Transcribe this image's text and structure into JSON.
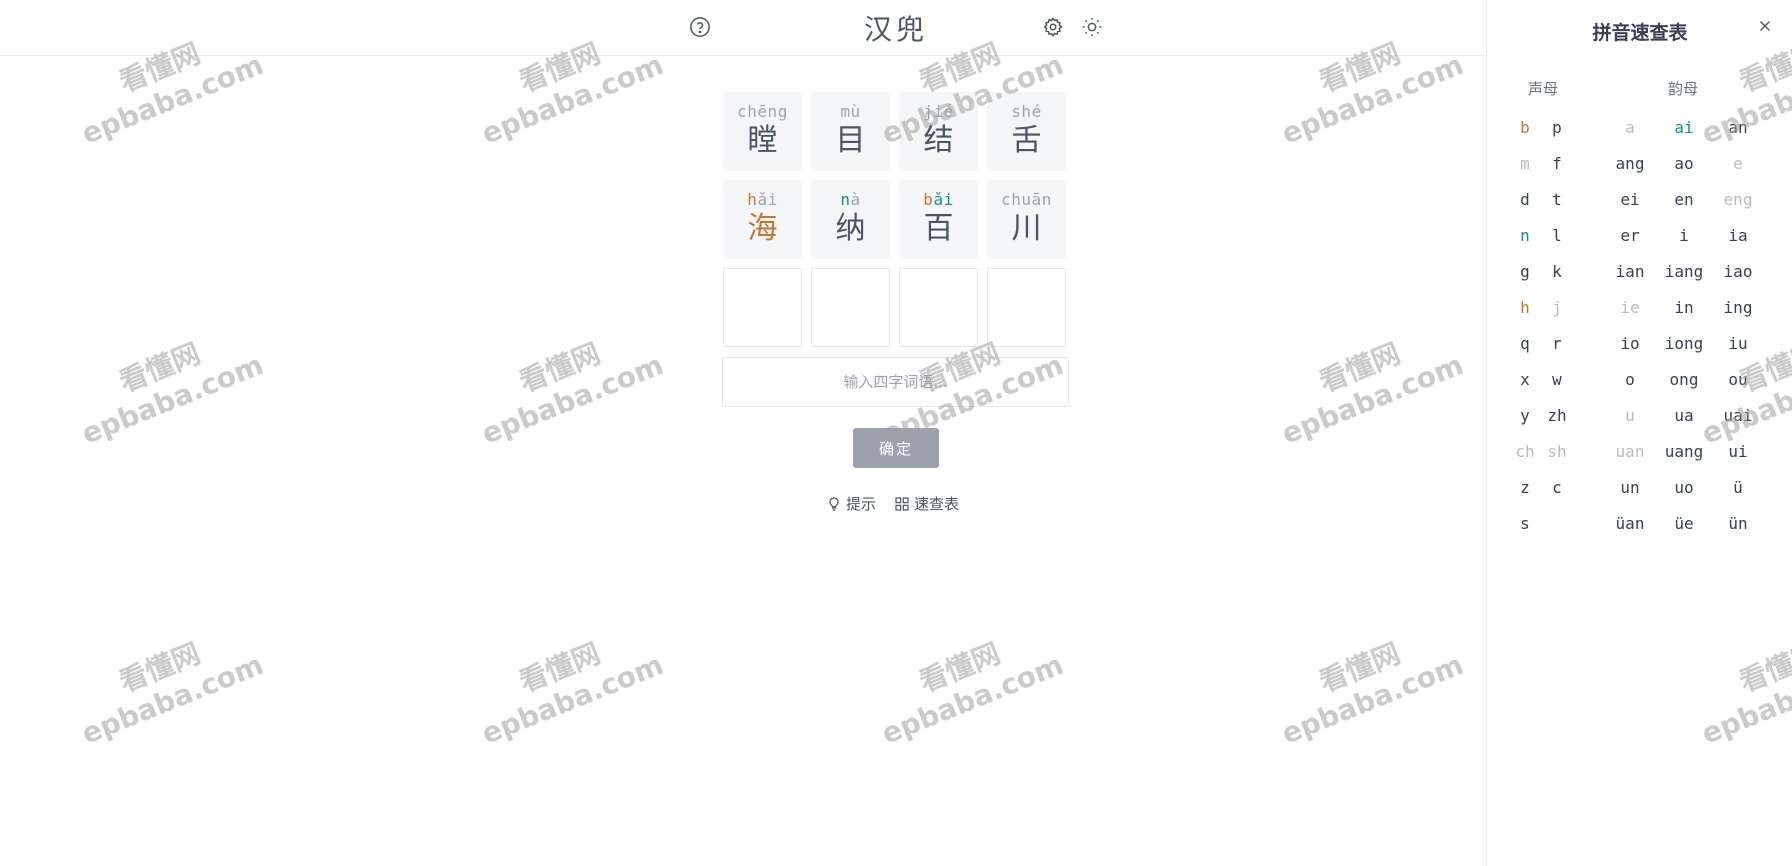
{
  "header": {
    "title": "汉兜",
    "help_icon": "help-circle-icon",
    "settings_icon": "gear-icon",
    "theme_icon": "sun-icon"
  },
  "colors": {
    "present": "#c2772f",
    "correct": "#14908a",
    "absent": "#9ca3af",
    "default": "#4b5563"
  },
  "board": {
    "rows": [
      [
        {
          "pinyin": [
            {
              "t": "ch",
              "s": "absent"
            },
            {
              "t": "ēng",
              "s": "absent"
            }
          ],
          "hanzi": "瞠",
          "hs": "default"
        },
        {
          "pinyin": [
            {
              "t": "m",
              "s": "absent"
            },
            {
              "t": "ù",
              "s": "absent"
            }
          ],
          "hanzi": "目",
          "hs": "default"
        },
        {
          "pinyin": [
            {
              "t": "j",
              "s": "absent"
            },
            {
              "t": "ié",
              "s": "absent"
            }
          ],
          "hanzi": "结",
          "hs": "default"
        },
        {
          "pinyin": [
            {
              "t": "sh",
              "s": "absent"
            },
            {
              "t": "é",
              "s": "absent"
            }
          ],
          "hanzi": "舌",
          "hs": "default"
        }
      ],
      [
        {
          "pinyin": [
            {
              "t": "h",
              "s": "present"
            },
            {
              "t": "ǎi",
              "s": "absent"
            }
          ],
          "hanzi": "海",
          "hs": "present"
        },
        {
          "pinyin": [
            {
              "t": "n",
              "s": "correct"
            },
            {
              "t": "à",
              "s": "absent"
            }
          ],
          "hanzi": "纳",
          "hs": "default"
        },
        {
          "pinyin": [
            {
              "t": "b",
              "s": "present"
            },
            {
              "t": "ǎi",
              "s": "correct"
            }
          ],
          "hanzi": "百",
          "hs": "default"
        },
        {
          "pinyin": [
            {
              "t": "ch",
              "s": "absent"
            },
            {
              "t": "uān",
              "s": "absent"
            }
          ],
          "hanzi": "川",
          "hs": "default"
        }
      ],
      [
        {
          "pinyin": [],
          "hanzi": "",
          "hs": "default"
        },
        {
          "pinyin": [],
          "hanzi": "",
          "hs": "default"
        },
        {
          "pinyin": [],
          "hanzi": "",
          "hs": "default"
        },
        {
          "pinyin": [],
          "hanzi": "",
          "hs": "default"
        }
      ]
    ]
  },
  "input": {
    "value": "",
    "placeholder": "输入四字词语..."
  },
  "confirm_label": "确定",
  "links": {
    "hint_label": "提示",
    "hint_icon": "lightbulb-icon",
    "cheatsheet_label": "速查表",
    "cheatsheet_icon": "grid-icon"
  },
  "panel": {
    "title": "拼音速查表",
    "close_icon": "close-icon",
    "initials_header": "声母",
    "finals_header": "韵母",
    "initials": [
      {
        "t": "b",
        "s": "present"
      },
      {
        "t": "p",
        "s": "default"
      },
      {
        "t": "m",
        "s": "absent"
      },
      {
        "t": "f",
        "s": "default"
      },
      {
        "t": "d",
        "s": "default"
      },
      {
        "t": "t",
        "s": "default"
      },
      {
        "t": "n",
        "s": "correct"
      },
      {
        "t": "l",
        "s": "default"
      },
      {
        "t": "g",
        "s": "default"
      },
      {
        "t": "k",
        "s": "default"
      },
      {
        "t": "h",
        "s": "present"
      },
      {
        "t": "j",
        "s": "absent"
      },
      {
        "t": "q",
        "s": "default"
      },
      {
        "t": "r",
        "s": "default"
      },
      {
        "t": "x",
        "s": "default"
      },
      {
        "t": "w",
        "s": "default"
      },
      {
        "t": "y",
        "s": "default"
      },
      {
        "t": "zh",
        "s": "default"
      },
      {
        "t": "ch",
        "s": "absent"
      },
      {
        "t": "sh",
        "s": "absent"
      },
      {
        "t": "z",
        "s": "default"
      },
      {
        "t": "c",
        "s": "default"
      },
      {
        "t": "s",
        "s": "default"
      }
    ],
    "finals": [
      {
        "t": "a",
        "s": "absent"
      },
      {
        "t": "ai",
        "s": "correct"
      },
      {
        "t": "an",
        "s": "default"
      },
      {
        "t": "ang",
        "s": "default"
      },
      {
        "t": "ao",
        "s": "default"
      },
      {
        "t": "e",
        "s": "absent"
      },
      {
        "t": "ei",
        "s": "default"
      },
      {
        "t": "en",
        "s": "default"
      },
      {
        "t": "eng",
        "s": "absent"
      },
      {
        "t": "er",
        "s": "default"
      },
      {
        "t": "i",
        "s": "default"
      },
      {
        "t": "ia",
        "s": "default"
      },
      {
        "t": "ian",
        "s": "default"
      },
      {
        "t": "iang",
        "s": "default"
      },
      {
        "t": "iao",
        "s": "default"
      },
      {
        "t": "ie",
        "s": "absent"
      },
      {
        "t": "in",
        "s": "default"
      },
      {
        "t": "ing",
        "s": "default"
      },
      {
        "t": "io",
        "s": "default"
      },
      {
        "t": "iong",
        "s": "default"
      },
      {
        "t": "iu",
        "s": "default"
      },
      {
        "t": "o",
        "s": "default"
      },
      {
        "t": "ong",
        "s": "default"
      },
      {
        "t": "ou",
        "s": "default"
      },
      {
        "t": "u",
        "s": "absent"
      },
      {
        "t": "ua",
        "s": "default"
      },
      {
        "t": "uai",
        "s": "default"
      },
      {
        "t": "uan",
        "s": "absent"
      },
      {
        "t": "uang",
        "s": "default"
      },
      {
        "t": "ui",
        "s": "default"
      },
      {
        "t": "un",
        "s": "default"
      },
      {
        "t": "uo",
        "s": "default"
      },
      {
        "t": "ü",
        "s": "default"
      },
      {
        "t": "üan",
        "s": "default"
      },
      {
        "t": "üe",
        "s": "default"
      },
      {
        "t": "ün",
        "s": "default"
      }
    ]
  },
  "watermark": {
    "line1": "看懂网",
    "line2": "epbaba.com"
  }
}
